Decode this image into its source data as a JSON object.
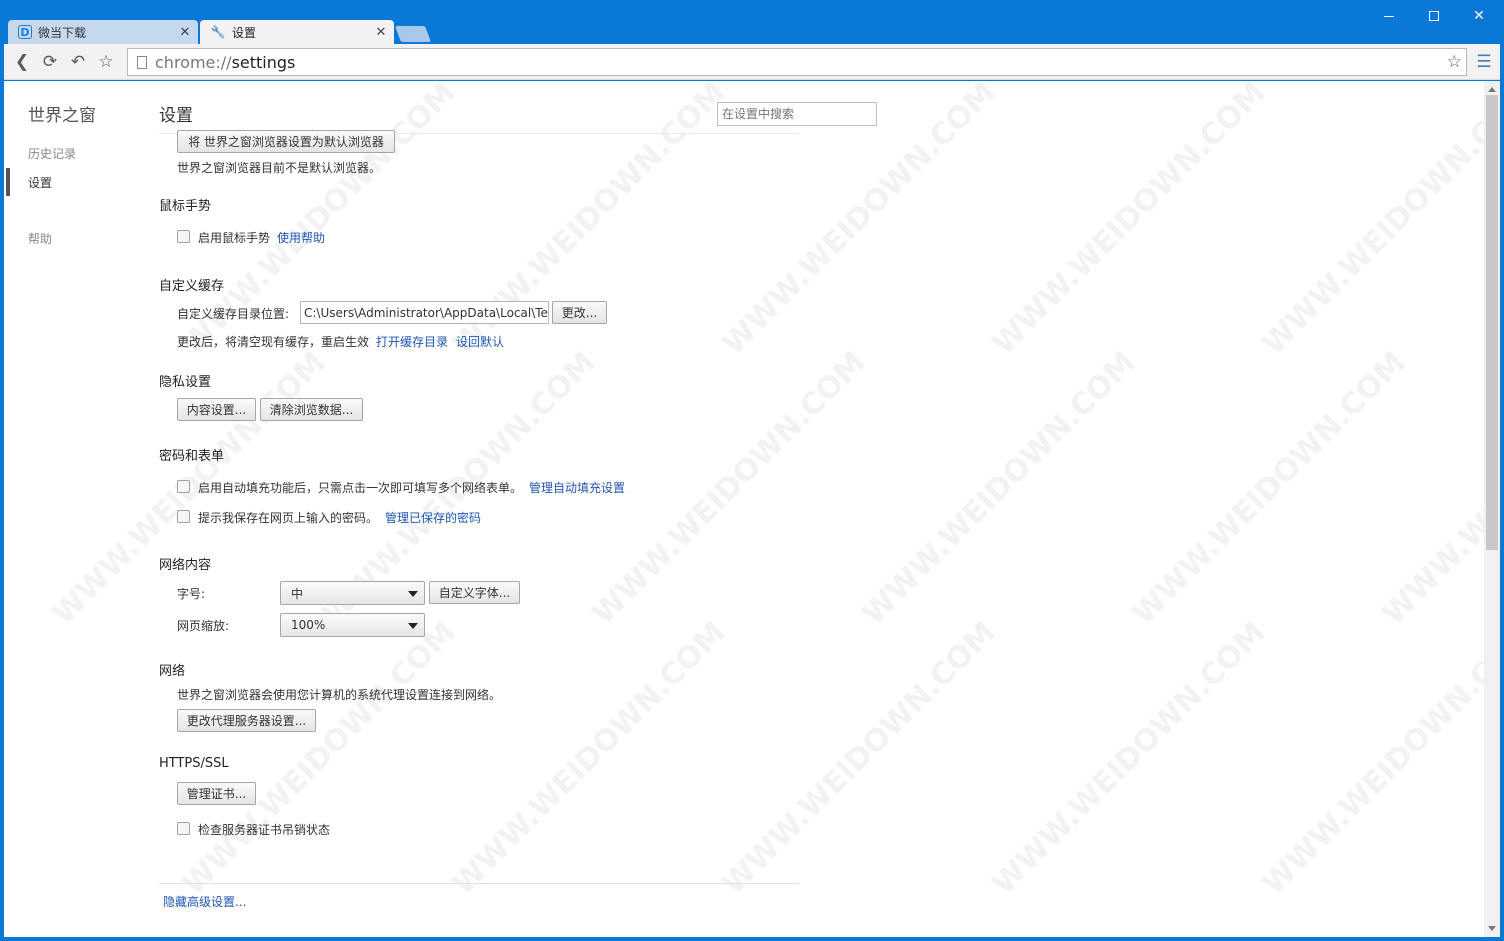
{
  "tabs": [
    {
      "title": "微当下载",
      "favicon": "weidown-logo-icon"
    },
    {
      "title": "设置",
      "favicon": "wrench-icon"
    }
  ],
  "address_bar": {
    "scheme": "chrome://",
    "path": "settings"
  },
  "sidebar": {
    "title": "世界之窗",
    "items": [
      {
        "label": "历史记录"
      },
      {
        "label": "设置",
        "active": true
      },
      {
        "label": "帮助"
      }
    ]
  },
  "header": {
    "title": "设置",
    "search_placeholder": "在设置中搜索"
  },
  "default_browser": {
    "button": "将 世界之窗浏览器设置为默认浏览器",
    "status": "世界之窗浏览器目前不是默认浏览器。"
  },
  "mouse_gesture": {
    "title": "鼠标手势",
    "checkbox_label": "启用鼠标手势",
    "help_link": "使用帮助",
    "checked": false
  },
  "cache": {
    "title": "自定义缓存",
    "path_label": "自定义缓存目录位置:",
    "path_value": "C:\\Users\\Administrator\\AppData\\Local\\Temp",
    "change_button": "更改...",
    "note": "更改后，将清空现有缓存，重启生效",
    "open_link": "打开缓存目录",
    "reset_link": "设回默认"
  },
  "privacy": {
    "title": "隐私设置",
    "content_button": "内容设置...",
    "clear_button": "清除浏览数据..."
  },
  "passwords": {
    "title": "密码和表单",
    "autofill_label": "启用自动填充功能后，只需点击一次即可填写多个网络表单。",
    "autofill_link": "管理自动填充设置",
    "autofill_checked": false,
    "save_pw_label": "提示我保存在网页上输入的密码。",
    "save_pw_link": "管理已保存的密码",
    "save_pw_checked": false
  },
  "web_content": {
    "title": "网络内容",
    "font_size_label": "字号:",
    "font_size_value": "中",
    "custom_fonts_button": "自定义字体...",
    "zoom_label": "网页缩放:",
    "zoom_value": "100%"
  },
  "network": {
    "title": "网络",
    "description": "世界之窗浏览器会使用您计算机的系统代理设置连接到网络。",
    "proxy_button": "更改代理服务器设置..."
  },
  "https": {
    "title": "HTTPS/SSL",
    "cert_button": "管理证书...",
    "revocation_label": "检查服务器证书吊销状态",
    "revocation_checked": false
  },
  "footer": {
    "hide_advanced_link": "隐藏高级设置..."
  },
  "watermark_text": "WWW.WEIDOWN.COM",
  "colors": {
    "titlebar": "#0a78d7",
    "link": "#1f56b5"
  }
}
